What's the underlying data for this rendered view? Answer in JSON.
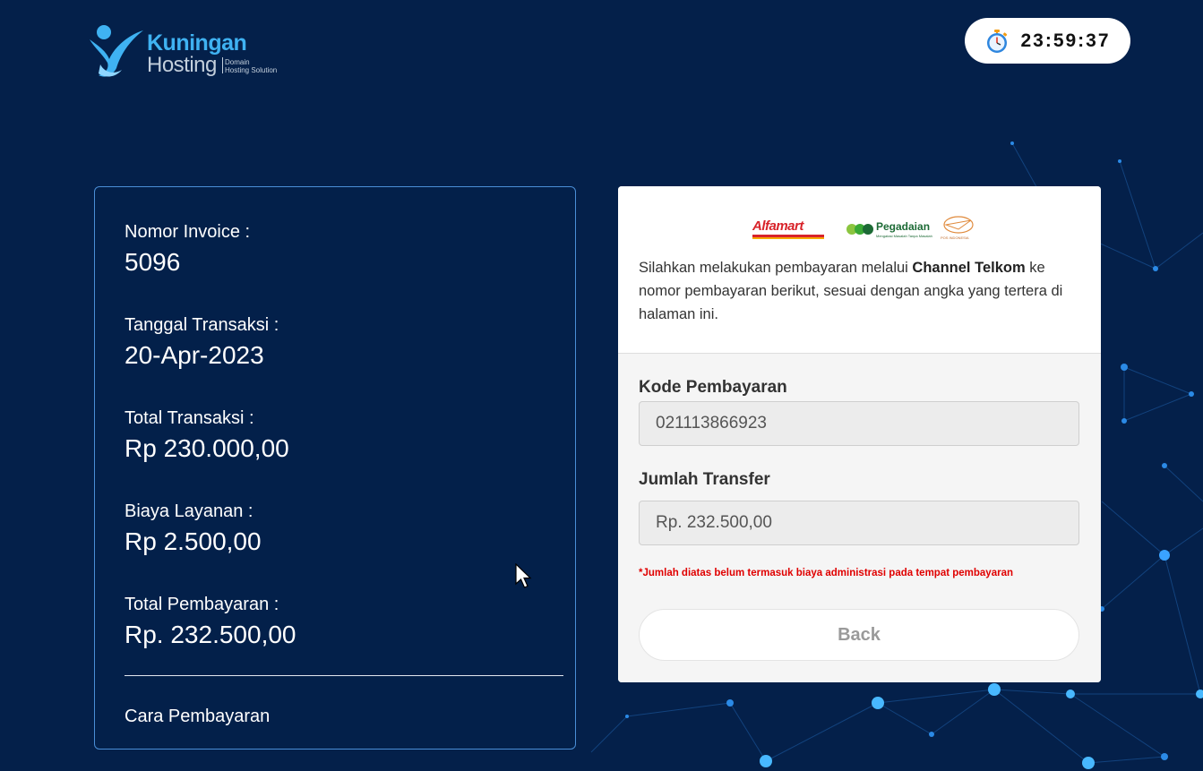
{
  "brand": {
    "name_line1": "Kuningan",
    "name_line2": "Hosting",
    "tagline_line1": "Domain",
    "tagline_line2": "Hosting Solution"
  },
  "timer": {
    "icon": "stopwatch-icon",
    "value": "23:59:37"
  },
  "invoice": {
    "items": [
      {
        "label": "Nomor Invoice :",
        "value": "5096"
      },
      {
        "label": "Tanggal Transaksi :",
        "value": "20-Apr-2023"
      },
      {
        "label": "Total Transaksi :",
        "value": "Rp 230.000,00"
      },
      {
        "label": "Biaya Layanan :",
        "value": "Rp 2.500,00"
      },
      {
        "label": "Total Pembayaran :",
        "value": "Rp. 232.500,00"
      }
    ],
    "how_to_pay": "Cara Pembayaran"
  },
  "payment": {
    "partners": {
      "alfamart": "Alfamart",
      "pegadaian": "Pegadaian",
      "pegadaian_tagline": "Mengatasi Masalah Tanpa Masalah",
      "pos": "POS INDONESIA"
    },
    "instruction_before": "Silahkan melakukan pembayaran melalui ",
    "instruction_channel": "Channel Telkom",
    "instruction_after": " ke nomor pembayaran berikut, sesuai dengan angka yang tertera di halaman ini.",
    "code_label": "Kode Pembayaran",
    "code_value": "021113866923",
    "amount_label": "Jumlah Transfer",
    "amount_value": "Rp. 232.500,00",
    "note": "*Jumlah diatas belum termasuk biaya administrasi pada tempat pembayaran",
    "back_label": "Back"
  },
  "colors": {
    "background": "#04204a",
    "brand_blue": "#3fb2f2",
    "note_red": "#e00000"
  }
}
